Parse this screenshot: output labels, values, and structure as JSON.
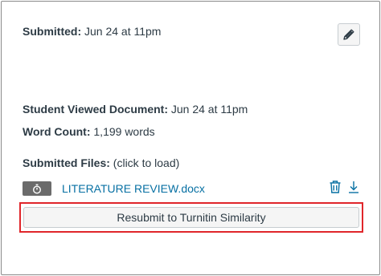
{
  "submission": {
    "submitted_label": "Submitted:",
    "submitted_value": "Jun 24 at 11pm",
    "viewed_label": "Student Viewed Document:",
    "viewed_value": "Jun 24 at 11pm",
    "word_count_label": "Word Count:",
    "word_count_value": "1,199 words",
    "files_label": "Submitted Files:",
    "files_hint": "(click to load)"
  },
  "file": {
    "name": "LITERATURE REVIEW.docx",
    "badge_icon": "stopwatch-icon"
  },
  "actions": {
    "edit_icon": "pencil-icon",
    "delete_icon": "trash-icon",
    "download_icon": "download-icon",
    "resubmit_label": "Resubmit to Turnitin Similarity"
  },
  "colors": {
    "link": "#0770a3",
    "highlight": "#e0262b"
  }
}
